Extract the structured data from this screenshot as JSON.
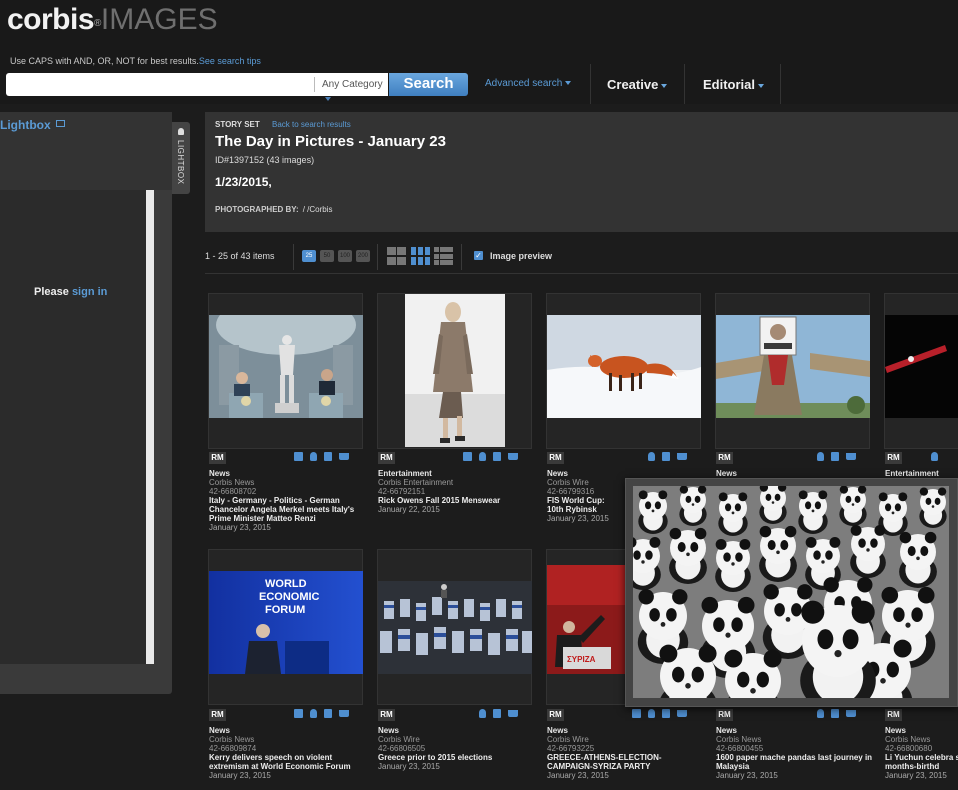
{
  "brand": {
    "logo_main": "corbis",
    "logo_reg": "®",
    "logo_sub": "IMAGES"
  },
  "search": {
    "tip_text": "Use CAPS with AND, OR, NOT for best results.",
    "tip_link": "See search tips",
    "placeholder": "",
    "category": "Any Category",
    "button": "Search",
    "advanced": "Advanced search"
  },
  "nav": {
    "creative": "Creative",
    "editorial": "Editorial"
  },
  "lightbox": {
    "title": "Lightbox",
    "prompt": "Please",
    "sign_in": "sign in",
    "tab_label": "LIGHTBOX"
  },
  "story": {
    "label": "STORY SET",
    "back": "Back to search results",
    "title": "The Day in Pictures - January 23",
    "id_line": "ID#1397152 (43 images)",
    "date": "1/23/2015,",
    "photographed_label": "PHOTOGRAPHED BY:",
    "photographed_value": "/ /Corbis"
  },
  "toolbar": {
    "count": "1 - 25 of 43 items",
    "per_page": [
      "25",
      "50",
      "100",
      "200"
    ],
    "preview": "Image preview"
  },
  "tiles": [
    {
      "rights": "RM",
      "category": "News",
      "source": "Corbis News",
      "id": "42-66808702",
      "caption": "Italy - Germany - Politics - German Chancelor Angela Merkel meets Italy's Prime Minister Matteo Renzi",
      "date": "January 23, 2015"
    },
    {
      "rights": "RM",
      "category": "Entertainment",
      "source": "Corbis Entertainment",
      "id": "42-66792151",
      "caption": "Rick Owens Fall 2015 Menswear",
      "date": "January 22, 2015"
    },
    {
      "rights": "RM",
      "category": "News",
      "source": "Corbis Wire",
      "id": "42-66799316",
      "caption": "FIS World Cup: 10th Rybinsk",
      "date": "January 23, 2015"
    },
    {
      "rights": "RM",
      "category": "News",
      "source": "",
      "id": "",
      "caption": "",
      "date": ""
    },
    {
      "rights": "RM",
      "category": "Entertainment",
      "source": "",
      "id": "",
      "caption": "",
      "date": ""
    },
    {
      "rights": "RM",
      "category": "News",
      "source": "Corbis News",
      "id": "42-66809874",
      "caption": "Kerry delivers speech on violent extremism at World Economic Forum",
      "date": "January 23, 2015"
    },
    {
      "rights": "RM",
      "category": "News",
      "source": "Corbis Wire",
      "id": "42-66806505",
      "caption": "Greece prior to 2015 elections",
      "date": "January 23, 2015"
    },
    {
      "rights": "RM",
      "category": "News",
      "source": "Corbis Wire",
      "id": "42-66793225",
      "caption": "GREECE-ATHENS-ELECTION-CAMPAIGN-SYRIZA PARTY",
      "date": "January 23, 2015"
    },
    {
      "rights": "RM",
      "category": "News",
      "source": "Corbis News",
      "id": "42-66800455",
      "caption": "1600 paper mache pandas last journey in Malaysia",
      "date": "January 23, 2015"
    },
    {
      "rights": "RM",
      "category": "News",
      "source": "Corbis News",
      "id": "42-66800680",
      "caption": "Li Yuchun celebra six-months-birthd",
      "date": "January 23, 2015"
    }
  ],
  "photo_text": {
    "wef_line1": "WORLD",
    "wef_line2": "ECONOMIC",
    "wef_line3": "FORUM",
    "syriza": "ΣΥΡΙΖΑ"
  },
  "colors": {
    "accent": "#4f8fd0",
    "link": "#5b9bd5",
    "background": "#1c1c1c",
    "panel": "#333333"
  }
}
